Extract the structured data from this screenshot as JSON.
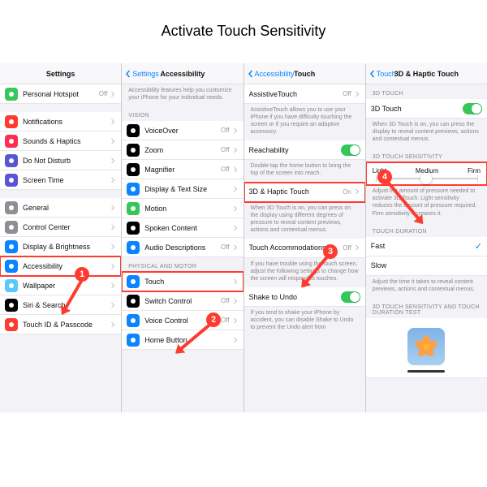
{
  "title": "Activate Touch Sensitivity",
  "panel1": {
    "header": "Settings",
    "items": [
      {
        "icon": "link",
        "bg": "#34c759",
        "label": "Personal Hotspot",
        "value": "Off"
      },
      {
        "sep": true
      },
      {
        "icon": "bell",
        "bg": "#ff3b30",
        "label": "Notifications"
      },
      {
        "icon": "sound",
        "bg": "#ff2d55",
        "label": "Sounds & Haptics"
      },
      {
        "icon": "moon",
        "bg": "#5856d6",
        "label": "Do Not Disturb"
      },
      {
        "icon": "hourglass",
        "bg": "#5856d6",
        "label": "Screen Time"
      },
      {
        "sep": true
      },
      {
        "icon": "gear",
        "bg": "#8e8e93",
        "label": "General"
      },
      {
        "icon": "switches",
        "bg": "#8e8e93",
        "label": "Control Center"
      },
      {
        "icon": "brightness",
        "bg": "#0a84ff",
        "label": "Display & Brightness"
      },
      {
        "icon": "access",
        "bg": "#0a84ff",
        "label": "Accessibility",
        "hl": true
      },
      {
        "icon": "wallpaper",
        "bg": "#5ac8fa",
        "label": "Wallpaper"
      },
      {
        "icon": "siri",
        "bg": "#000",
        "label": "Siri & Search"
      },
      {
        "icon": "touchid",
        "bg": "#ff3b30",
        "label": "Touch ID & Passcode"
      }
    ]
  },
  "panel2": {
    "back": "Settings",
    "header": "Accessibility",
    "intro": "Accessibility features help you customize your iPhone for your individual needs.",
    "sections": [
      {
        "title": "VISION",
        "items": [
          {
            "icon": "voiceover",
            "bg": "#000",
            "label": "VoiceOver",
            "value": "Off"
          },
          {
            "icon": "zoom",
            "bg": "#000",
            "label": "Zoom",
            "value": "Off"
          },
          {
            "icon": "magnifier",
            "bg": "#000",
            "label": "Magnifier",
            "value": "Off"
          },
          {
            "icon": "text",
            "bg": "#0a84ff",
            "label": "Display & Text Size"
          },
          {
            "icon": "motion",
            "bg": "#34c759",
            "label": "Motion"
          },
          {
            "icon": "spoken",
            "bg": "#000",
            "label": "Spoken Content"
          },
          {
            "icon": "audio",
            "bg": "#0a84ff",
            "label": "Audio Descriptions",
            "value": "Off"
          }
        ]
      },
      {
        "title": "PHYSICAL AND MOTOR",
        "items": [
          {
            "icon": "touch",
            "bg": "#0a84ff",
            "label": "Touch",
            "hl": true
          },
          {
            "icon": "switch",
            "bg": "#000",
            "label": "Switch Control",
            "value": "Off"
          },
          {
            "icon": "voice",
            "bg": "#0a84ff",
            "label": "Voice Control",
            "value": "Off"
          },
          {
            "icon": "home",
            "bg": "#0a84ff",
            "label": "Home Button"
          }
        ]
      }
    ]
  },
  "panel3": {
    "back": "Accessibility",
    "header": "Touch",
    "groups": [
      {
        "rows": [
          {
            "label": "AssistiveTouch",
            "value": "Off",
            "chev": true
          }
        ],
        "desc": "AssistiveTouch allows you to use your iPhone if you have difficulty touching the screen or if you require an adaptive accessory."
      },
      {
        "rows": [
          {
            "label": "Reachability",
            "toggle": "on"
          }
        ],
        "desc": "Double-tap the home button to bring the top of the screen into reach."
      },
      {
        "rows": [
          {
            "label": "3D & Haptic Touch",
            "value": "On",
            "chev": true,
            "hl": true
          }
        ],
        "desc": "When 3D Touch is on, you can press on the display using different degrees of pressure to reveal content previews, actions and contextual menus."
      },
      {
        "rows": [
          {
            "label": "Touch Accommodations",
            "value": "Off",
            "chev": true
          }
        ],
        "desc": "If you have trouble using the touch screen, adjust the following settings to change how the screen will respond to touches."
      },
      {
        "rows": [
          {
            "label": "Shake to Undo",
            "toggle": "on"
          }
        ],
        "desc": "If you tend to shake your iPhone by accident, you can disable Shake to Undo to prevent the Undo alert from"
      }
    ]
  },
  "panel4": {
    "back": "Touch",
    "header": "3D & Haptic Touch",
    "s1": {
      "title": "3D TOUCH",
      "row": {
        "label": "3D Touch",
        "toggle": "on"
      },
      "desc": "When 3D Touch is on, you can press the display to reveal content previews, actions and contextual menus."
    },
    "s2": {
      "title": "3D TOUCH SENSITIVITY",
      "labels": [
        "Light",
        "Medium",
        "Firm"
      ],
      "pos": 50,
      "desc": "Adjust the amount of pressure needed to activate 3D Touch. Light sensitivity reduces the amount of pressure required. Firm sensitivity increases it."
    },
    "s3": {
      "title": "TOUCH DURATION",
      "rows": [
        {
          "label": "Fast",
          "check": true
        },
        {
          "label": "Slow"
        }
      ],
      "desc": "Adjust the time it takes to reveal content previews, actions and contextual menus."
    },
    "s4": {
      "title": "3D TOUCH SENSITIVITY AND TOUCH DURATION TEST"
    }
  },
  "annotations": {
    "n1": "1",
    "n2": "2",
    "n3": "3",
    "n4": "4"
  }
}
